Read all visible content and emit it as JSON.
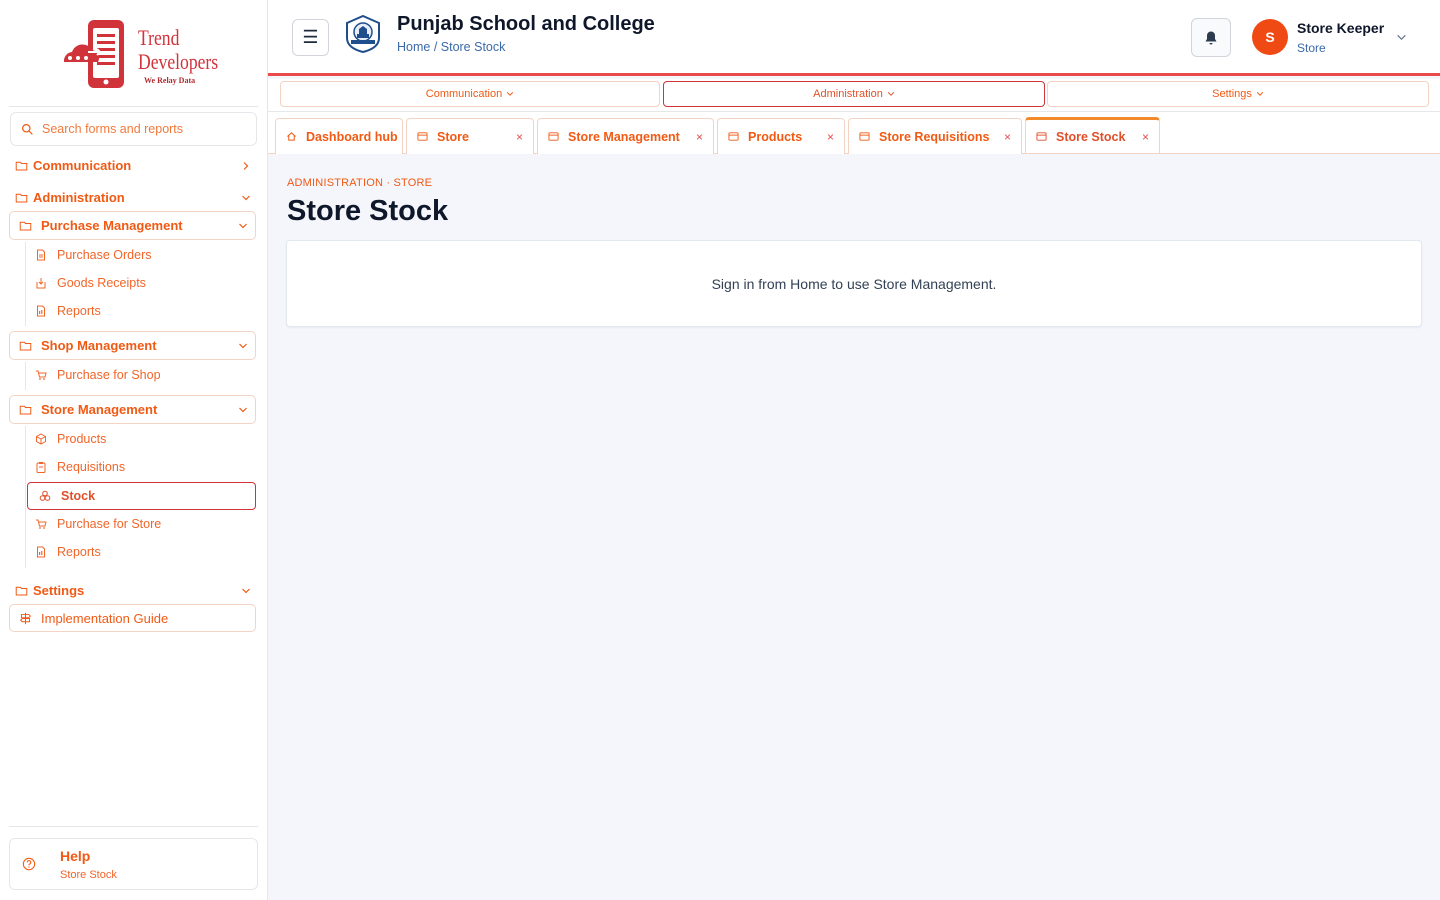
{
  "brand": {
    "line1": "Trend",
    "line2": "Developers",
    "tagline": "We Relay Data",
    "accent": "#d0343a",
    "orange": "#f05a14"
  },
  "search": {
    "placeholder": "Search forms and reports"
  },
  "sidebar": {
    "sections": [
      {
        "label": "Communication"
      },
      {
        "label": "Administration"
      },
      {
        "label": "Settings"
      }
    ],
    "groups": {
      "purchase": {
        "label": "Purchase Management",
        "items": [
          "Purchase Orders",
          "Goods Receipts",
          "Reports"
        ]
      },
      "shop": {
        "label": "Shop Management",
        "items": [
          "Purchase for Shop"
        ]
      },
      "store": {
        "label": "Store Management",
        "items": [
          "Products",
          "Requisitions",
          "Stock",
          "Purchase for Store",
          "Reports"
        ]
      }
    },
    "implementation_guide": "Implementation Guide",
    "help": {
      "title": "Help",
      "subtitle": "Store Stock"
    }
  },
  "header": {
    "school_name": "Punjab School and College",
    "breadcrumb": "Home / Store Stock",
    "menu_icon": "☰",
    "user": {
      "initial": "S",
      "name": "Store Keeper",
      "role": "Store"
    }
  },
  "menubar": [
    "Communication",
    "Administration",
    "Settings"
  ],
  "tabs": [
    {
      "label": "Dashboard hub",
      "icon": "home-icon"
    },
    {
      "label": "Store",
      "icon": "window-icon",
      "close": "×"
    },
    {
      "label": "Store Management",
      "icon": "window-icon",
      "close": "×"
    },
    {
      "label": "Products",
      "icon": "window-icon",
      "close": "×"
    },
    {
      "label": "Store Requisitions",
      "icon": "window-icon",
      "close": "×"
    },
    {
      "label": "Store Stock",
      "icon": "window-icon",
      "close": "×"
    }
  ],
  "page": {
    "kicker": "ADMINISTRATION · STORE",
    "title": "Store Stock",
    "message": "Sign in from Home to use Store Management."
  }
}
